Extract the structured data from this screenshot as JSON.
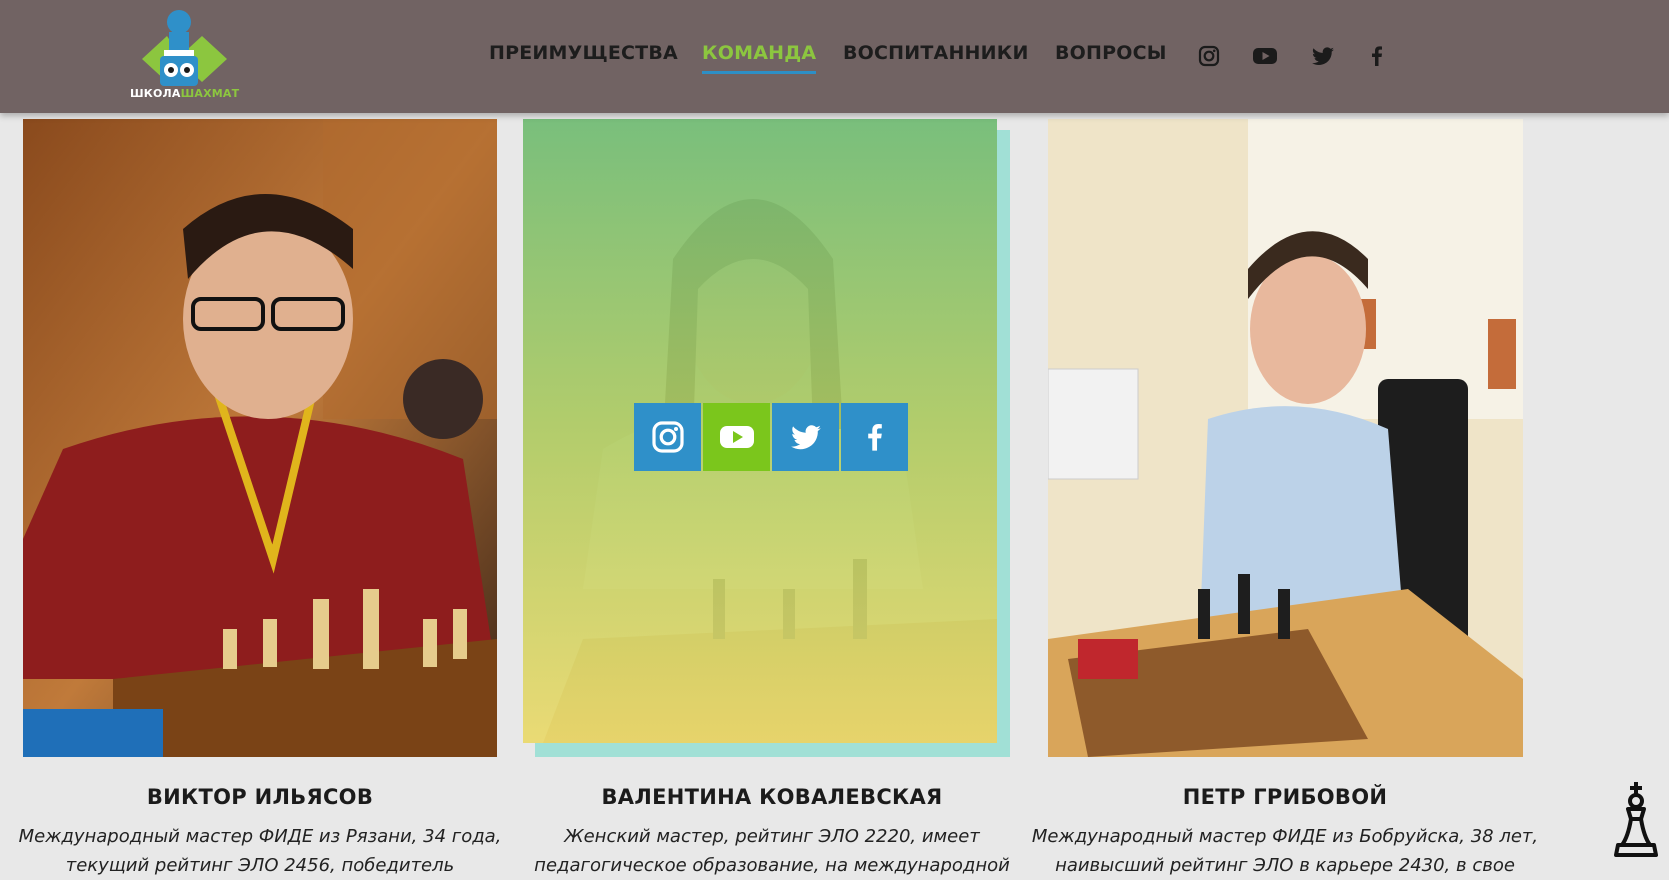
{
  "logo": {
    "text_part1": "ШКОЛА",
    "text_part2": "ШАХМАТ"
  },
  "nav": {
    "items": [
      {
        "label": "ПРЕИМУЩЕСТВА",
        "active": false
      },
      {
        "label": "КОМАНДА",
        "active": true
      },
      {
        "label": "ВОСПИТАННИКИ",
        "active": false
      },
      {
        "label": "ВОПРОСЫ",
        "active": false
      }
    ],
    "social_icons": [
      "instagram-icon",
      "youtube-icon",
      "twitter-icon",
      "facebook-icon"
    ]
  },
  "team": [
    {
      "name": "ВИКТОР ИЛЬЯСОВ",
      "desc_line1": "Международный мастер ФИДЕ из Рязани, 34 года,",
      "desc_line2": "текущий рейтинг ЭЛО 2456, победитель"
    },
    {
      "name": "ВАЛЕНТИНА КОВАЛЕВСКАЯ",
      "desc_line1": "Женский мастер, рейтинг ЭЛО 2220, имеет",
      "desc_line2": "педагогическое образование, на международной",
      "hover_social": [
        "instagram-icon",
        "youtube-icon",
        "twitter-icon",
        "facebook-icon"
      ]
    },
    {
      "name": "ПЕТР ГРИБОВОЙ",
      "desc_line1": "Международный мастер ФИДЕ из Бобруйска, 38 лет,",
      "desc_line2": "наивысший рейтинг ЭЛО в карьере 2430, в свое"
    }
  ],
  "colors": {
    "header_bg": "#716363",
    "accent_green": "#8cc63f",
    "accent_blue": "#2f90c9",
    "teal": "#a1e0d6"
  }
}
